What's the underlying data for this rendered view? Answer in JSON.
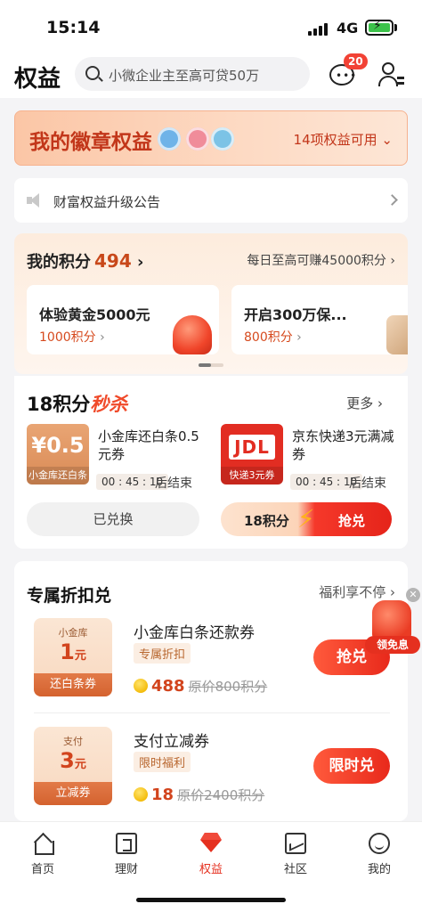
{
  "status_bar": {
    "time": "15:14",
    "network": "4G"
  },
  "header": {
    "title": "权益",
    "search_placeholder": "小微企业主至高可贷50万",
    "message_badge": "20"
  },
  "badge_banner": {
    "title": "我的徽章权益",
    "available": "14项权益可用"
  },
  "notice": {
    "text": "财富权益升级公告"
  },
  "points": {
    "title": "我的积分",
    "value": "494",
    "earn_text": "每日至高可赚45000积分",
    "offers": [
      {
        "title": "体验黄金5000元",
        "cost": "1000积分"
      },
      {
        "title": "开启300万保...",
        "cost": "800积分"
      }
    ]
  },
  "flash_sale": {
    "title_prefix": "18积分",
    "title_suffix": "秒杀",
    "more": "更多",
    "items": [
      {
        "image_big": "¥0.5",
        "image_small": "小金库还白条",
        "name": "小金库还白条0.5元券",
        "timer": "00 : 45 : 10",
        "ends": "后结束",
        "button": "已兑换"
      },
      {
        "image_big": "JDL",
        "image_small": "快递3元券",
        "name": "京东快递3元满减券",
        "timer": "00 : 45 : 10",
        "ends": "后结束",
        "button_points": "18积分",
        "button": "抢兑"
      }
    ]
  },
  "discount": {
    "title": "专属折扣兑",
    "more": "福利享不停",
    "items": [
      {
        "voucher_top": "小金库",
        "voucher_amount": "1",
        "voucher_unit": "元",
        "voucher_bottom": "还白条券",
        "name": "小金库白条还款券",
        "tag": "专属折扣",
        "points": "488",
        "original": "原价800积分",
        "button": "抢兑"
      },
      {
        "voucher_top": "支付",
        "voucher_amount": "3",
        "voucher_unit": "元",
        "voucher_bottom": "立减券",
        "name": "支付立减券",
        "tag": "限时福利",
        "points": "18",
        "original": "原价2400积分",
        "button": "限时兑"
      }
    ]
  },
  "float_promo": {
    "label": "领免息"
  },
  "tabbar": {
    "tabs": [
      {
        "label": "首页",
        "icon": "home-icon"
      },
      {
        "label": "理财",
        "icon": "wealth-icon"
      },
      {
        "label": "权益",
        "icon": "gem-icon",
        "active": true
      },
      {
        "label": "社区",
        "icon": "community-icon"
      },
      {
        "label": "我的",
        "icon": "mine-icon"
      }
    ]
  },
  "colors": {
    "accent": "#e5301f",
    "banner": "#fbc6a6",
    "points_value": "#c8481a"
  }
}
